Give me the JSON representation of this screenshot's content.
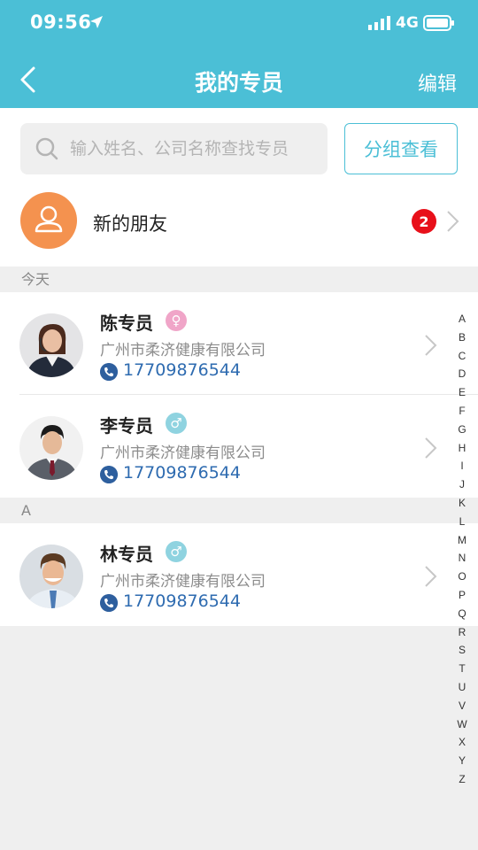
{
  "status": {
    "time": "09:56",
    "network": "4G"
  },
  "nav": {
    "title": "我的专员",
    "edit_label": "编辑"
  },
  "search": {
    "placeholder": "输入姓名、公司名称查找专员",
    "value": ""
  },
  "group_button": {
    "label": "分组查看"
  },
  "new_friends": {
    "label": "新的朋友",
    "badge": "2"
  },
  "sections": [
    {
      "title": "今天",
      "contacts": [
        {
          "name": "陈专员",
          "gender": "female",
          "gender_symbol": "♀",
          "company": "广州市柔济健康有限公司",
          "phone": "17709876544"
        },
        {
          "name": "李专员",
          "gender": "male",
          "gender_symbol": "♂",
          "company": "广州市柔济健康有限公司",
          "phone": "17709876544"
        }
      ]
    },
    {
      "title": "A",
      "contacts": [
        {
          "name": "林专员",
          "gender": "male",
          "gender_symbol": "♂",
          "company": "广州市柔济健康有限公司",
          "phone": "17709876544"
        }
      ]
    }
  ],
  "index_letters": [
    "A",
    "B",
    "C",
    "D",
    "E",
    "F",
    "G",
    "H",
    "I",
    "J",
    "K",
    "L",
    "M",
    "N",
    "O",
    "P",
    "Q",
    "R",
    "S",
    "T",
    "U",
    "V",
    "W",
    "X",
    "Y",
    "Z"
  ],
  "colors": {
    "primary": "#4bbfd6",
    "badge": "#e8101a",
    "avatar_orange": "#f4924f",
    "phone": "#2e6bb0"
  }
}
